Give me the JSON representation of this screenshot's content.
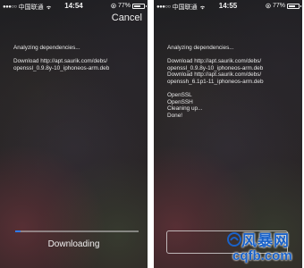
{
  "left_screen": {
    "statusbar": {
      "carrier": "中国联通",
      "time": "14:54",
      "battery_percent": "77%",
      "battery_level": 0.77
    },
    "cancel_label": "Cancel",
    "log_lines": [
      "Analyzing dependencies...",
      "",
      "Download http://apt.saurik.com/debs/",
      "openssl_0.9.8y-10_iphoneos-arm.deb"
    ],
    "progress": 0.04,
    "progress_color": "#2f7cf6",
    "status_label": "Downloading"
  },
  "right_screen": {
    "statusbar": {
      "carrier": "中国联通",
      "time": "14:55",
      "battery_percent": "77%",
      "battery_level": 0.77
    },
    "log_lines": [
      "Analyzing dependencies...",
      "",
      "Download http://apt.saurik.com/debs/",
      "openssl_0.9.8y-10_iphoneos-arm.deb",
      "Download http://apt.saurik.com/debs/",
      "openssh_6.1p1-11_iphoneos-arm.deb",
      "",
      "OpenSSL",
      "OpenSSH",
      "Cleaning up...",
      "Done!"
    ]
  },
  "watermark": {
    "brand_text": "风暴网",
    "url_text": "cqfb.com",
    "color": "#1a62c9"
  }
}
